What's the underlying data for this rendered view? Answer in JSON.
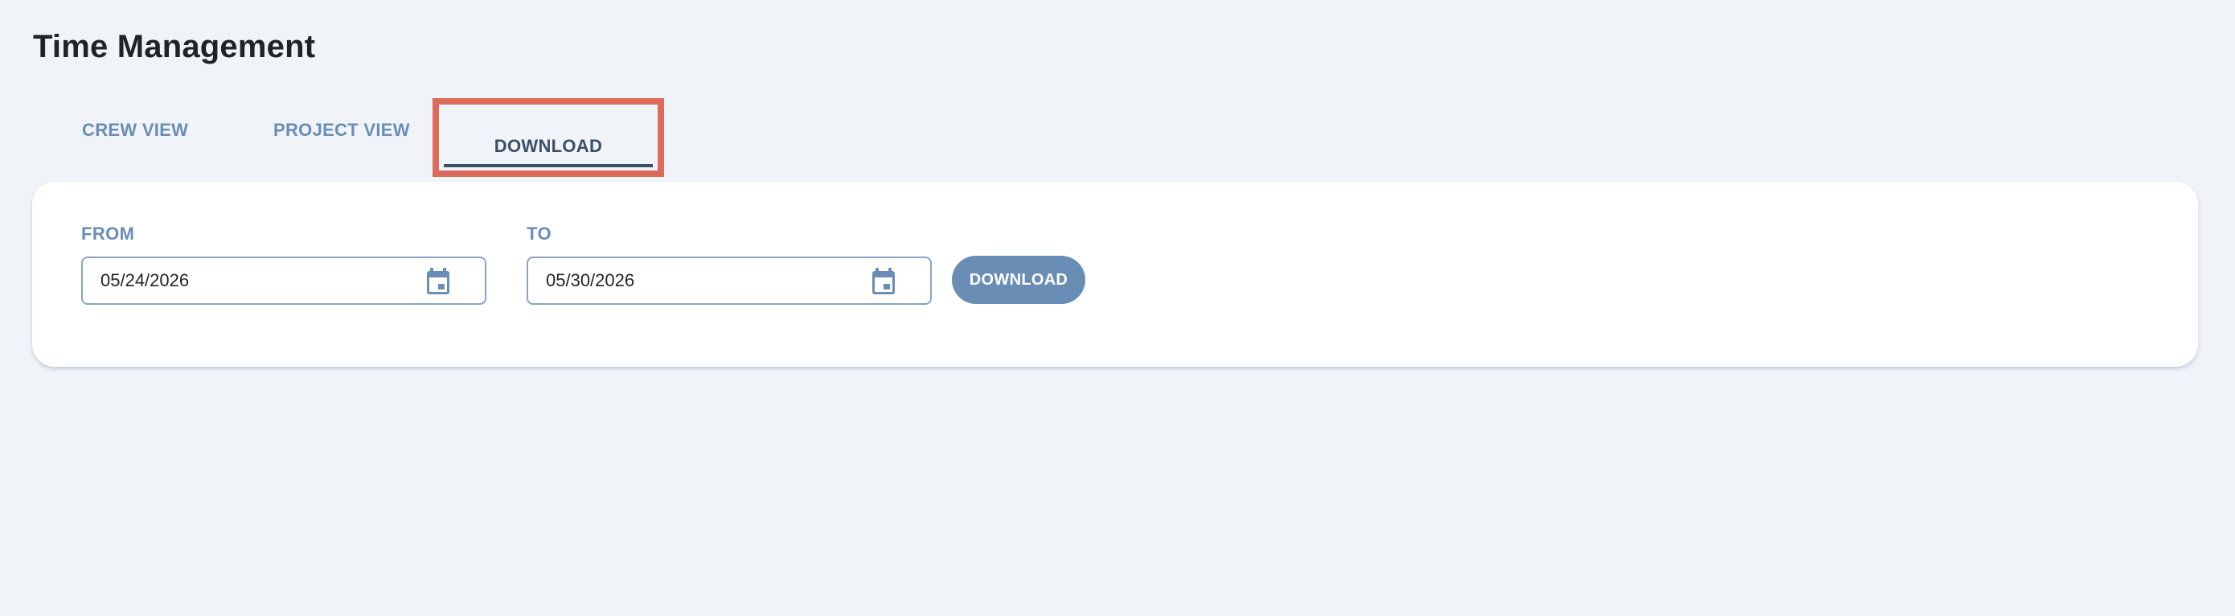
{
  "page": {
    "title": "Time Management"
  },
  "tabs": [
    {
      "label": "CREW VIEW",
      "active": false
    },
    {
      "label": "PROJECT VIEW",
      "active": false
    },
    {
      "label": "DOWNLOAD",
      "active": true
    }
  ],
  "download_form": {
    "from_label": "FROM",
    "from_value": "05/24/2026",
    "to_label": "TO",
    "to_value": "05/30/2026",
    "button_label": "DOWNLOAD"
  },
  "icons": {
    "date_picker": "calendar-icon"
  },
  "colors": {
    "accent": "#6a8db5",
    "active_tab": "#3b4f65",
    "highlight": "#dd6b5b",
    "background": "#f0f3f8"
  }
}
